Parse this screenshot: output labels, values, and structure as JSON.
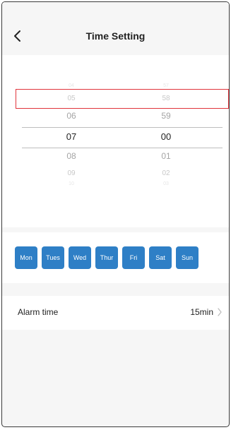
{
  "header": {
    "title": "Time Setting",
    "back_icon": "chevron-left-icon"
  },
  "picker": {
    "hours": [
      "04",
      "05",
      "06",
      "07",
      "08",
      "09",
      "10"
    ],
    "minutes": [
      "57",
      "58",
      "59",
      "00",
      "01",
      "02",
      "03"
    ],
    "selected_hour": "07",
    "selected_minute": "00"
  },
  "days": [
    "Mon",
    "Tues",
    "Wed",
    "Thur",
    "Fri",
    "Sat",
    "Sun"
  ],
  "alarm": {
    "label": "Alarm time",
    "value": "15min",
    "chevron_icon": "chevron-right-icon"
  },
  "colors": {
    "accent": "#2e7fc6",
    "highlight_border": "#e0343b"
  }
}
